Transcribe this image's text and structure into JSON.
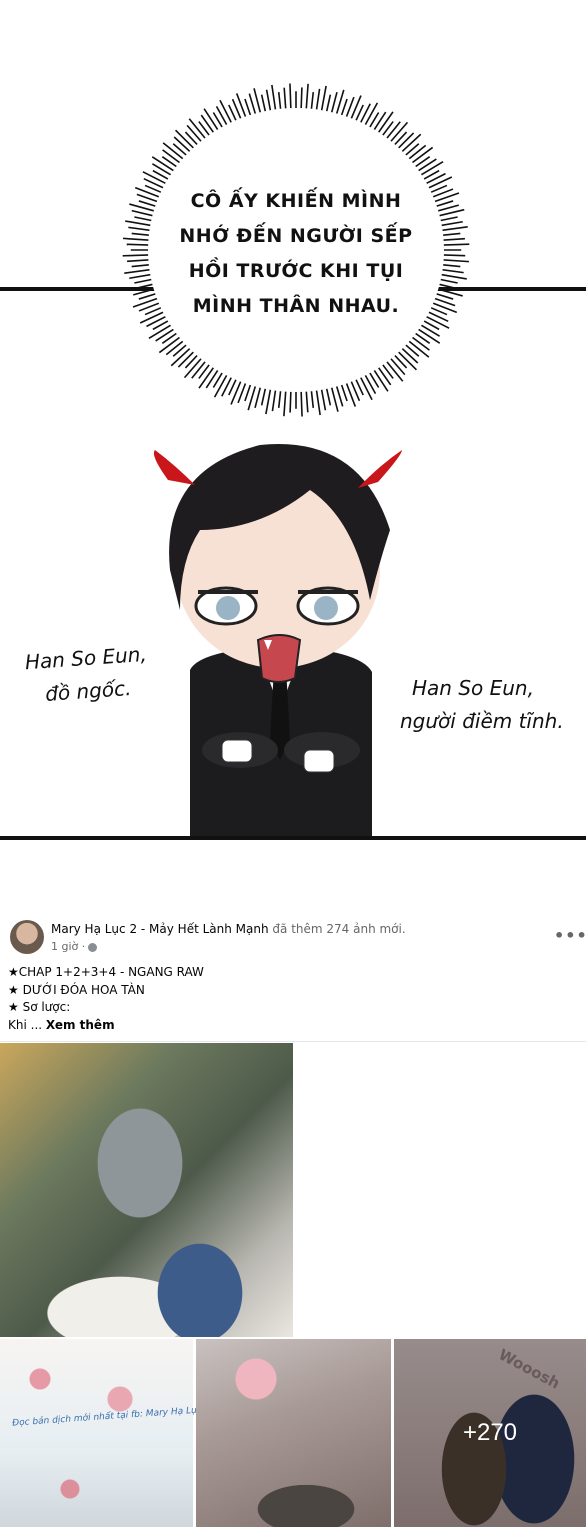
{
  "comic": {
    "bubble_lines": [
      "CÔ ẤY KHIẾN MÌNH",
      "NHỚ ĐẾN NGƯỜI SẾP",
      "HỒI TRƯỚC KHI TỤI",
      "MÌNH THÂN NHAU."
    ],
    "left_caption": [
      "Han So Eun,",
      "đồ ngốc."
    ],
    "right_caption": [
      "Han So Eun,",
      "người điềm tĩnh."
    ]
  },
  "post": {
    "author": "Mary Hạ Lục 2 - Mảy Hết Lành Mạnh",
    "action": "đã thêm 274 ảnh mới.",
    "time": "1 giờ ·",
    "more_label": "•••",
    "lines": [
      "★CHAP 1+2+3+4 - NGANG RAW",
      "★ DƯỚI ĐÓA HOA TÀN",
      "★ Sơ lược:"
    ],
    "truncated_prefix": "Khi ...",
    "see_more": "Xem thêm",
    "watermark": "Đọc bản dịch mới nhất tại fb: Mary Hạ Lục",
    "woosh_text": "Wooosh",
    "extra_photos": "+270"
  },
  "colors": {
    "link": "#050505",
    "muted": "#65676b",
    "horn": "#c8161b"
  }
}
